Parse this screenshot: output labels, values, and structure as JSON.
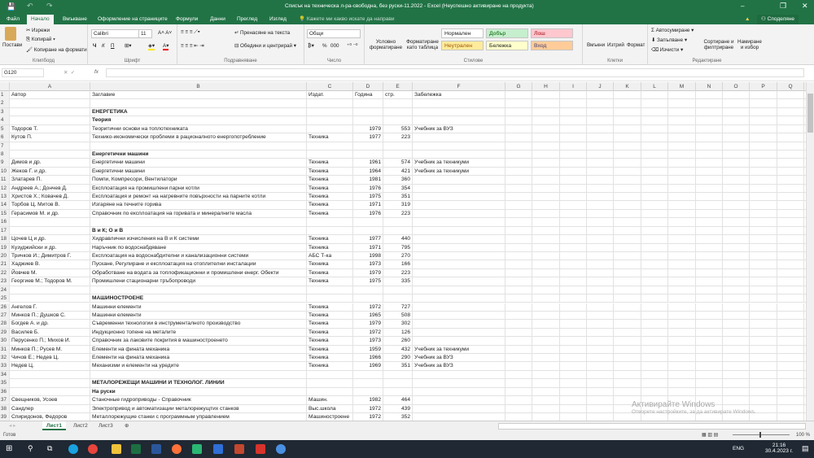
{
  "title": "Списък на техническа л-ра-свободна, без руски-11.2022 - Excel (Неуспешно активиране на продукта)",
  "share": "Споделяне",
  "tabs": [
    "Файл",
    "Начало",
    "Вмъкване",
    "Оформление на страниците",
    "Формули",
    "Данни",
    "Преглед",
    "Изглед"
  ],
  "tell_me": "Кажете ми какво искате да направи",
  "ribbon": {
    "clipboard": {
      "paste": "Постави",
      "cut": "Изрежи",
      "copy": "Копирай",
      "format_painter": "Копиране на формати",
      "label": "Клипборд"
    },
    "font": {
      "name": "Calibri",
      "size": "11",
      "bold": "Ч",
      "italic": "К",
      "underline": "П",
      "label": "Шрифт"
    },
    "alignment": {
      "wrap": "Пренасяне на текста",
      "merge": "Обедини и центрирай",
      "label": "Подравняване"
    },
    "number": {
      "format": "Общи",
      "percent": "%",
      "thousands": "000",
      "label": "Число"
    },
    "styles": {
      "conditional": "Условно форматиране",
      "as_table": "Форматиране като таблица",
      "items": [
        "Нормален",
        "Добър",
        "Лош",
        "Неутрален",
        "Бележка",
        "Вход"
      ],
      "label": "Стилове"
    },
    "cells": {
      "insert": "Вмъкни",
      "delete": "Изтрий",
      "format": "Формат",
      "label": "Клетки"
    },
    "editing": {
      "autosum": "Автосумиране",
      "fill": "Запълване",
      "clear": "Изчисти",
      "sort": "Сортиране и филтриране",
      "find": "Намиране и избор",
      "label": "Редактиране"
    }
  },
  "namebox": "G120",
  "fx": "fx",
  "columns": [
    "A",
    "B",
    "C",
    "D",
    "E",
    "F",
    "G",
    "H",
    "I",
    "J",
    "K",
    "L",
    "M",
    "N",
    "O",
    "P",
    "Q"
  ],
  "rows": [
    [
      "Автор",
      "Заглавие",
      "Издат.",
      "Година",
      "стр.",
      "Забележка",
      0
    ],
    [
      "",
      "",
      "",
      "",
      "",
      "",
      0
    ],
    [
      "",
      "ЕНЕРГЕТИКА",
      "",
      "",
      "",
      "",
      1
    ],
    [
      "",
      "Теория",
      "",
      "",
      "",
      "",
      1
    ],
    [
      "Тодоров Т.",
      "Теоритични основи на топлотехниката",
      "",
      "1979",
      "553",
      "Учебник за ВУЗ",
      0
    ],
    [
      "Кутов П.",
      "Технико-икономически проблеми в рационалното енергопотребление",
      "Техника",
      "1977",
      "223",
      "",
      0
    ],
    [
      "",
      "",
      "",
      "",
      "",
      "",
      0
    ],
    [
      "",
      "Енергетични машини",
      "",
      "",
      "",
      "",
      1
    ],
    [
      "Димов и др.",
      "Енергетични машини",
      "Техника",
      "1961",
      "574",
      "Учебник за техникуми",
      0
    ],
    [
      "Жеков Г. и др.",
      "Енергетични машини",
      "Техника",
      "1964",
      "421",
      "Учебник за техникуми",
      0
    ],
    [
      "Златарев П.",
      "Помпи, Компресори, Вентилатори",
      "Техника",
      "1981",
      "360",
      "",
      0
    ],
    [
      "Андреев А.; Дончев Д.",
      "Експлоатация на промишлени парни котли",
      "Техника",
      "1976",
      "354",
      "",
      0
    ],
    [
      "Христов Х.; Ковачев Д.",
      "Експлоатация и ремонт на нагревните повърхности на парните котли",
      "Техника",
      "1975",
      "351",
      "",
      0
    ],
    [
      "Торбов Ц. Митов В.",
      "Изгаряне на течните горива",
      "Техника",
      "1971",
      "319",
      "",
      0
    ],
    [
      "Герасимов М. и др.",
      "Справочник по експлоатация на горивата и минералните масла",
      "Техника",
      "1976",
      "223",
      "",
      0
    ],
    [
      "",
      "",
      "",
      "",
      "",
      "",
      0
    ],
    [
      "",
      "В и К; О и В",
      "",
      "",
      "",
      "",
      1
    ],
    [
      "Цочев Ц и др.",
      "Хидравлични изчисления на В и К системи",
      "Техника",
      "1977",
      "440",
      "",
      0
    ],
    [
      "Кузуджийски и др.",
      "Наръчник по водоснабдяване",
      "Техника",
      "1971",
      "795",
      "",
      0
    ],
    [
      "Тричков И.; Димитров Г.",
      "Експлоатация на водоснабдителни и канализационни системи",
      "АБС Т-ка",
      "1998",
      "270",
      "",
      0
    ],
    [
      "Хаджиев В.",
      "Пускане, Регулиране и експлоатация на отоплителни инсталации",
      "Техника",
      "1973",
      "166",
      "",
      0
    ],
    [
      "Йовчев М.",
      "Обработване на водата за топлофикационни и промишлени енерг. Обекти",
      "Техника",
      "1979",
      "223",
      "",
      0
    ],
    [
      "Георгиев М.; Тодоров М.",
      "Промишлени стационарни тръбопроводи",
      "Техника",
      "1975",
      "335",
      "",
      0
    ],
    [
      "",
      "",
      "",
      "",
      "",
      "",
      0
    ],
    [
      "",
      "МАШИНОСТРОЕНЕ",
      "",
      "",
      "",
      "",
      1
    ],
    [
      "Ангелов Г.",
      "Машинни елементи",
      "Техника",
      "1972",
      "727",
      "",
      0
    ],
    [
      "Минков П.; Душков С.",
      "Машинни елементи",
      "Техника",
      "1965",
      "508",
      "",
      0
    ],
    [
      "Богдев А. и др.",
      "Съвременни технологии в инструменталното производство",
      "Техника",
      "1979",
      "302",
      "",
      0
    ],
    [
      "Василев Б.",
      "Индукционно топене на металите",
      "Техника",
      "1972",
      "126",
      "",
      0
    ],
    [
      "Перусенко П.; Михов И.",
      "Справочник за лаковите покрития в машиностроенето",
      "Техника",
      "1973",
      "260",
      "",
      0
    ],
    [
      "Минков П.; Русев М.",
      "Елементи на фината механика",
      "Техника",
      "1959",
      "432",
      "Учебник за техникуми",
      0
    ],
    [
      "Чичов Е.; Недев Ц.",
      "Елементи на фината механика",
      "Техника",
      "1966",
      "290",
      "Учебник за ВУЗ",
      0
    ],
    [
      "Недев Ц.",
      "Механизми и елементи на уредите",
      "Техника",
      "1969",
      "351",
      "Учебник за ВУЗ",
      0
    ],
    [
      "",
      "",
      "",
      "",
      "",
      "",
      0
    ],
    [
      "",
      "МЕТАЛОРЕЖЕЩИ МАШИНИ И ТЕХНОЛОГ. ЛИНИИ",
      "",
      "",
      "",
      "",
      1
    ],
    [
      "",
      "На руски",
      "",
      "",
      "",
      "",
      1
    ],
    [
      "Свещников, Усоев",
      "Станочные гидроприводы - Справочник",
      "Машин.",
      "1982",
      "464",
      "",
      0
    ],
    [
      "Сандлер",
      "Электропривод и автоматизации металорежущтих станков",
      "Выс.школа",
      "1972",
      "439",
      "",
      0
    ],
    [
      "Спиридонов, Федоров",
      "Металлорежущие станки с программным управлением",
      "Машиностроене",
      "1972",
      "352",
      "",
      0
    ]
  ],
  "sheets": [
    "Лист1",
    "Лист2",
    "Лист3"
  ],
  "status": "Готов",
  "zoom": "100 %",
  "watermark": {
    "title": "Активирайте Windows",
    "sub": "Отворете настройките, за да активирате Windows."
  },
  "tray": {
    "lang": "ENG",
    "time": "21:16",
    "date": "30.4.2023 г."
  },
  "colors": {
    "excel_green": "#217346",
    "good": "#c6efce",
    "bad": "#ffc7ce",
    "neutral": "#ffeb9c",
    "input": "#ffcc99"
  }
}
